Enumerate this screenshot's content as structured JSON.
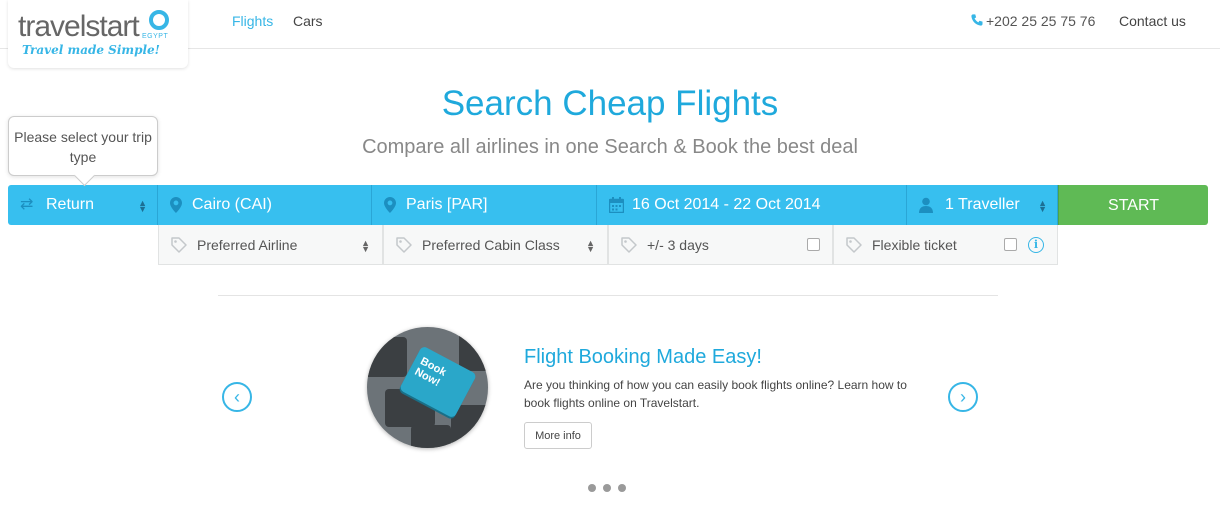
{
  "header": {
    "logo": {
      "wordmark": "travelstart",
      "country": "EGYPT",
      "tagline": "Travel made Simple!"
    },
    "nav": [
      {
        "label": "Flights",
        "active": true
      },
      {
        "label": "Cars",
        "active": false
      }
    ],
    "phone": "+202 25 25 75 76",
    "contact_label": "Contact us"
  },
  "hero": {
    "title": "Search Cheap Flights",
    "subtitle": "Compare all airlines in one Search & Book the best deal"
  },
  "tooltip": {
    "text": "Please select your trip type"
  },
  "search": {
    "trip_type": "Return",
    "from": "Cairo (CAI)",
    "to": "Paris [PAR]",
    "dates": "16 Oct 2014 -  22 Oct 2014",
    "travellers": "1 Traveller",
    "start_label": "START"
  },
  "options": {
    "airline": "Preferred Airline",
    "cabin": "Preferred Cabin Class",
    "days": "+/- 3 days",
    "flexible": "Flexible ticket",
    "days_checked": false,
    "flexible_checked": false
  },
  "promo": {
    "title": "Flight Booking Made Easy!",
    "text": "Are you thinking of how you can easily book flights online? Learn how to book flights online on Travelstart.",
    "button": "More info",
    "key_label": "Book Now!",
    "slides": 3
  },
  "colors": {
    "accent": "#37bfef",
    "start": "#5fba55",
    "title": "#1fa9dc"
  },
  "icons": [
    "swap-icon",
    "location-pin-icon",
    "calendar-icon",
    "person-icon",
    "tag-icon",
    "info-icon",
    "phone-icon",
    "chevron-left-icon",
    "chevron-right-icon"
  ]
}
